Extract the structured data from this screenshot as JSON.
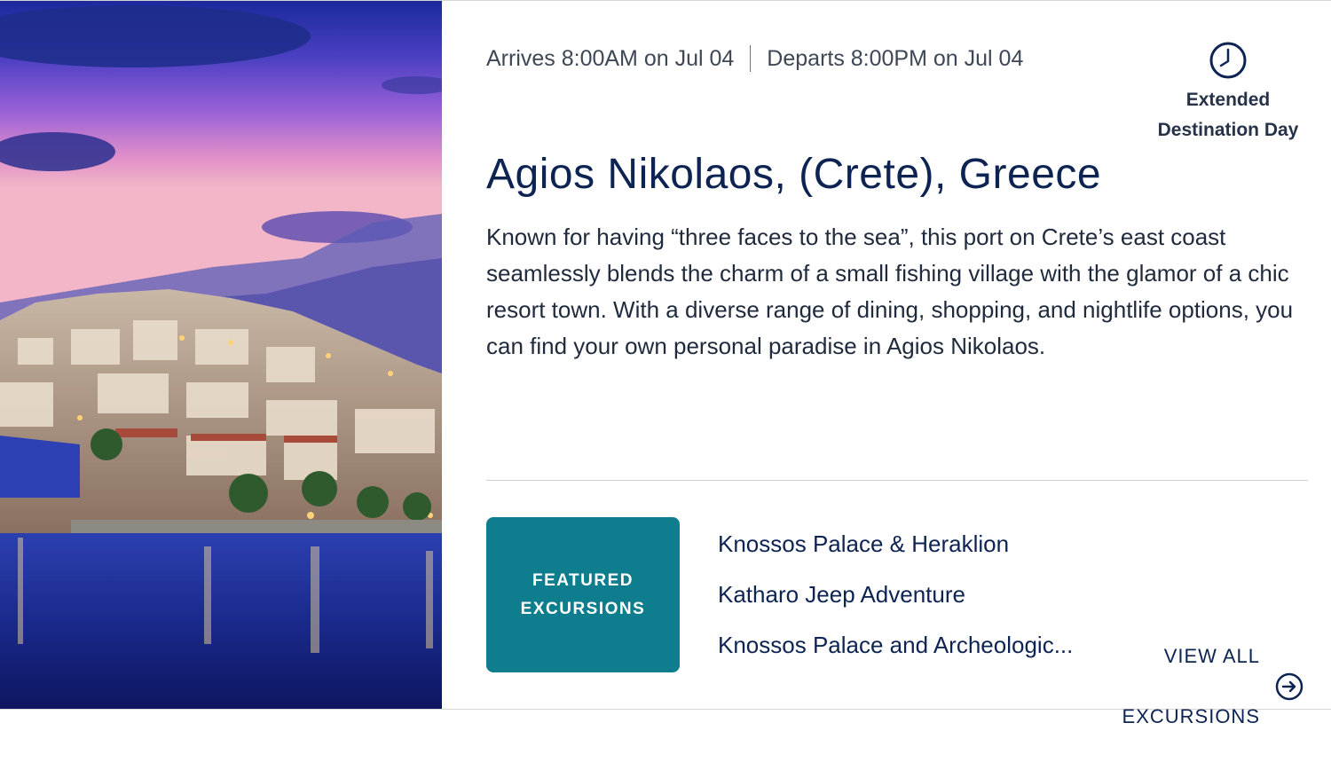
{
  "photo": {
    "alt": "Agios Nikolaos harbor at dusk"
  },
  "schedule": {
    "arrives": "Arrives 8:00AM on Jul 04",
    "departs": "Departs 8:00PM on Jul 04"
  },
  "extended_day": {
    "icon": "clock-icon",
    "label_line1": "Extended",
    "label_line2": "Destination Day"
  },
  "port": {
    "title": "Agios Nikolaos, (Crete), Greece",
    "description": "Known for having “three faces to the sea”, this port on Crete’s east coast seamlessly blends the charm of a small fishing village with the glamor of a chic resort town. With a diverse range of dining, shopping, and nightlife options, you can find your own personal paradise in Agios Nikolaos."
  },
  "featured": {
    "line1": "FEATURED",
    "line2": "EXCURSIONS",
    "color": "#0e7d8d"
  },
  "excursions": [
    "Knossos Palace & Heraklion",
    "Katharo Jeep Adventure",
    "Knossos Palace and Archeologic..."
  ],
  "view_all": {
    "line1": "VIEW ALL",
    "line2": "EXCURSIONS",
    "icon": "arrow-circle-right-icon"
  },
  "colors": {
    "navy": "#0d2453",
    "teal": "#0e7d8d"
  }
}
